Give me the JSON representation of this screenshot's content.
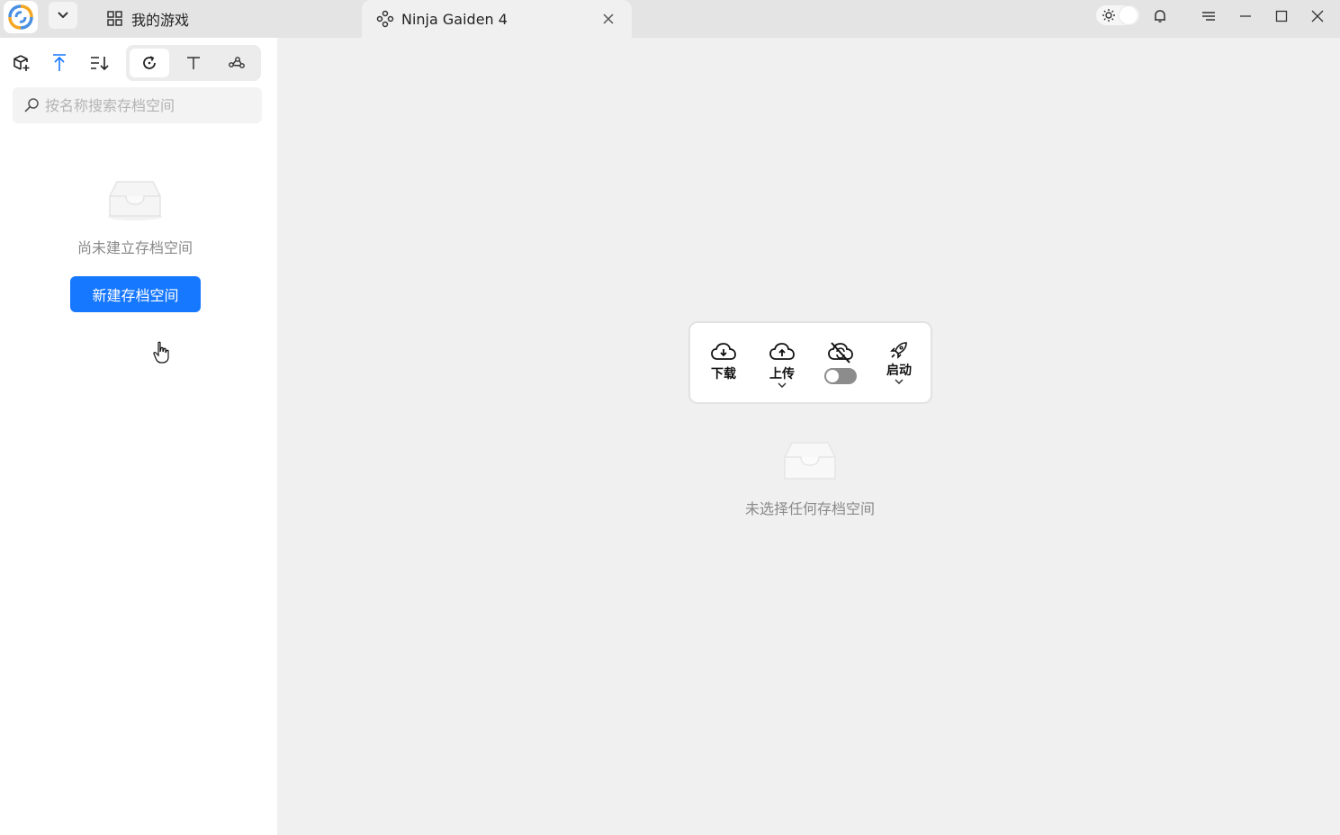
{
  "titlebar": {
    "tabs": [
      {
        "label": "我的游戏",
        "icon": "grid-icon"
      },
      {
        "label": "Ninja Gaiden 4",
        "icon": "gamepad-icon",
        "active": true
      }
    ],
    "controls": [
      "theme-toggle",
      "bell-icon",
      "menu-icon",
      "minimize-icon",
      "maximize-icon",
      "close-icon"
    ]
  },
  "sidebar": {
    "toolbar": [
      "add-box-icon",
      "sort-up-icon",
      "sort-list-icon",
      "refresh-icon",
      "text-icon",
      "share-icon"
    ],
    "search": {
      "placeholder": "按名称搜索存档空间",
      "value": ""
    },
    "empty_text": "尚未建立存档空间",
    "create_button": "新建存档空间"
  },
  "main": {
    "actions": {
      "download": "下载",
      "upload": "上传",
      "launch": "启动",
      "sync_enabled": false
    },
    "empty_text": "未选择任何存档空间"
  },
  "colors": {
    "accent": "#1677ff",
    "toggle_off": "#8c8c8c"
  }
}
